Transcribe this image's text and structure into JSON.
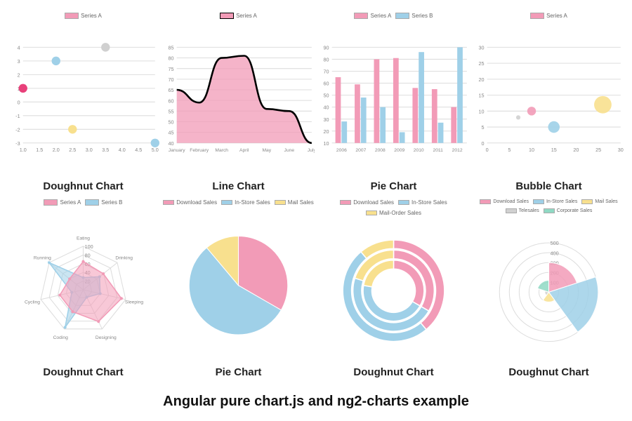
{
  "caption": "Angular pure chart.js and ng2-charts example",
  "colors": {
    "pink": "#f29bb7",
    "blue": "#9fd0e8",
    "yellow": "#f8e08e",
    "teal": "#8fd9c4",
    "grey": "#d0d0d0",
    "magenta": "#e8407a"
  },
  "charts": [
    {
      "id": "scatter",
      "title": "Doughnut Chart",
      "legend": [
        "Series A"
      ]
    },
    {
      "id": "line",
      "title": "Line Chart",
      "legend": [
        "Series A"
      ]
    },
    {
      "id": "bar",
      "title": "Pie Chart",
      "legend": [
        "Series A",
        "Series B"
      ]
    },
    {
      "id": "bubble",
      "title": "Bubble Chart",
      "legend": [
        "Series A"
      ]
    },
    {
      "id": "radar",
      "title": "Doughnut Chart",
      "legend": [
        "Series A",
        "Series B"
      ]
    },
    {
      "id": "pie",
      "title": "Pie Chart",
      "legend": [
        "Download Sales",
        "In-Store Sales",
        "Mail Sales"
      ]
    },
    {
      "id": "doughnut",
      "title": "Doughnut Chart",
      "legend": [
        "Download Sales",
        "In-Store Sales",
        "Mail-Order Sales"
      ]
    },
    {
      "id": "polar",
      "title": "Doughnut Chart",
      "legend": [
        "Download Sales",
        "In-Store Sales",
        "Mail Sales",
        "Telesales",
        "Corporate Sales"
      ]
    }
  ],
  "chart_data": [
    {
      "type": "scatter",
      "title": "Doughnut Chart",
      "xlim": [
        1.0,
        5.0
      ],
      "ylim": [
        -3,
        4
      ],
      "x_ticks": [
        1.0,
        1.5,
        2.0,
        2.5,
        3.0,
        3.5,
        4.0,
        4.5,
        5.0
      ],
      "y_ticks": [
        -3,
        -2,
        -1,
        0,
        1,
        2,
        3,
        4
      ],
      "series": [
        {
          "name": "Series A",
          "points": [
            {
              "x": 1.0,
              "y": 1,
              "r": 6,
              "color": "#e8407a"
            },
            {
              "x": 2.0,
              "y": 3,
              "r": 6,
              "color": "#9fd0e8"
            },
            {
              "x": 2.5,
              "y": -2,
              "r": 6,
              "color": "#f8e08e"
            },
            {
              "x": 3.5,
              "y": 4,
              "r": 6,
              "color": "#d0d0d0"
            },
            {
              "x": 5.0,
              "y": -3,
              "r": 6,
              "color": "#9fd0e8"
            }
          ]
        }
      ]
    },
    {
      "type": "area",
      "title": "Line Chart",
      "categories": [
        "January",
        "February",
        "March",
        "April",
        "May",
        "June",
        "July"
      ],
      "ylim": [
        40,
        85
      ],
      "y_ticks": [
        40,
        45,
        50,
        55,
        60,
        65,
        70,
        75,
        80,
        85
      ],
      "series": [
        {
          "name": "Series A",
          "values": [
            65,
            59,
            80,
            81,
            56,
            55,
            40
          ],
          "color": "#f29bb7",
          "stroke": "#000"
        }
      ]
    },
    {
      "type": "bar",
      "title": "Pie Chart",
      "categories": [
        "2006",
        "2007",
        "2008",
        "2009",
        "2010",
        "2011",
        "2012"
      ],
      "ylim": [
        10,
        90
      ],
      "y_ticks": [
        10,
        20,
        30,
        40,
        50,
        60,
        70,
        80,
        90
      ],
      "series": [
        {
          "name": "Series A",
          "values": [
            65,
            59,
            80,
            81,
            56,
            55,
            40
          ],
          "color": "#f29bb7"
        },
        {
          "name": "Series B",
          "values": [
            28,
            48,
            40,
            19,
            86,
            27,
            90
          ],
          "color": "#9fd0e8"
        }
      ]
    },
    {
      "type": "bubble",
      "title": "Bubble Chart",
      "xlim": [
        0,
        30
      ],
      "ylim": [
        0,
        30
      ],
      "x_ticks": [
        0,
        5,
        10,
        15,
        20,
        25,
        30
      ],
      "y_ticks": [
        0,
        5,
        10,
        15,
        20,
        25,
        30
      ],
      "series": [
        {
          "name": "Series A",
          "points": [
            {
              "x": 7,
              "y": 8,
              "r": 3,
              "color": "#d0d0d0"
            },
            {
              "x": 10,
              "y": 10,
              "r": 6,
              "color": "#f29bb7"
            },
            {
              "x": 15,
              "y": 5,
              "r": 8,
              "color": "#9fd0e8"
            },
            {
              "x": 26,
              "y": 12,
              "r": 12,
              "color": "#f8e08e"
            }
          ]
        }
      ]
    },
    {
      "type": "radar",
      "title": "Doughnut Chart",
      "categories": [
        "Eating",
        "Drinking",
        "Sleeping",
        "Designing",
        "Coding",
        "Cycling",
        "Running"
      ],
      "ticks": [
        20,
        40,
        60,
        80,
        100
      ],
      "series": [
        {
          "name": "Series A",
          "values": [
            65,
            59,
            90,
            81,
            56,
            55,
            40
          ],
          "color": "#f29bb7"
        },
        {
          "name": "Series B",
          "values": [
            28,
            48,
            40,
            19,
            96,
            27,
            100
          ],
          "color": "#9fd0e8"
        }
      ]
    },
    {
      "type": "pie",
      "title": "Pie Chart",
      "slices": [
        {
          "name": "Download Sales",
          "value": 300,
          "color": "#f29bb7"
        },
        {
          "name": "In-Store Sales",
          "value": 500,
          "color": "#9fd0e8"
        },
        {
          "name": "Mail Sales",
          "value": 100,
          "color": "#f8e08e"
        }
      ]
    },
    {
      "type": "doughnut",
      "title": "Doughnut Chart",
      "rings": [
        [
          {
            "name": "Download Sales",
            "value": 350,
            "color": "#f29bb7"
          },
          {
            "name": "In-Store Sales",
            "value": 450,
            "color": "#9fd0e8"
          },
          {
            "name": "Mail-Order Sales",
            "value": 100,
            "color": "#f8e08e"
          }
        ],
        [
          {
            "name": "Download Sales",
            "value": 250,
            "color": "#f29bb7"
          },
          {
            "name": "In-Store Sales",
            "value": 350,
            "color": "#9fd0e8"
          },
          {
            "name": "Mail-Order Sales",
            "value": 150,
            "color": "#f8e08e"
          }
        ],
        [
          {
            "name": "Download Sales",
            "value": 300,
            "color": "#f29bb7"
          },
          {
            "name": "In-Store Sales",
            "value": 400,
            "color": "#9fd0e8"
          },
          {
            "name": "Mail-Order Sales",
            "value": 200,
            "color": "#f8e08e"
          }
        ]
      ]
    },
    {
      "type": "polar",
      "title": "Doughnut Chart",
      "ticks": [
        100,
        200,
        300,
        400,
        500
      ],
      "slices": [
        {
          "name": "Download Sales",
          "value": 300,
          "color": "#f29bb7"
        },
        {
          "name": "In-Store Sales",
          "value": 500,
          "color": "#9fd0e8"
        },
        {
          "name": "Mail Sales",
          "value": 100,
          "color": "#f8e08e"
        },
        {
          "name": "Telesales",
          "value": 40,
          "color": "#d0d0d0"
        },
        {
          "name": "Corporate Sales",
          "value": 120,
          "color": "#8fd9c4"
        }
      ]
    }
  ]
}
